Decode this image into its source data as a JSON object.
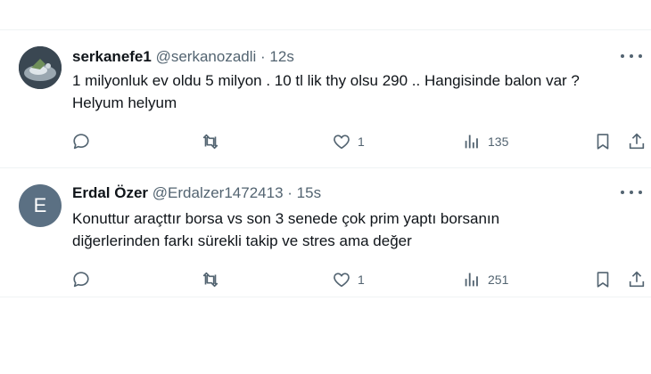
{
  "tweets": [
    {
      "name": "serkanefe1",
      "handle": "@serkanozadli",
      "separator": "·",
      "time": "12s",
      "text_lines": [
        "1 milyonluk ev oldu 5 milyon . 10 tl lik thy olsu 290 .. Hangisinde balon var ?",
        "Helyum helyum"
      ],
      "likes": "1",
      "views": "135"
    },
    {
      "name": "Erdal Özer",
      "handle": "@Erdalzer1472413",
      "separator": "·",
      "time": "15s",
      "avatar_letter": "E",
      "text_lines": [
        "Konuttur araçttır borsa vs son 3 senede çok prim yaptı  borsanın",
        "diğerlerinden farkı sürekli takip ve stres  ama değer"
      ],
      "likes": "1",
      "views": "251"
    }
  ],
  "colors": {
    "secondary_text": "#536471",
    "divider": "#eff3f4",
    "letter_avatar_bg": "#5b7083"
  }
}
